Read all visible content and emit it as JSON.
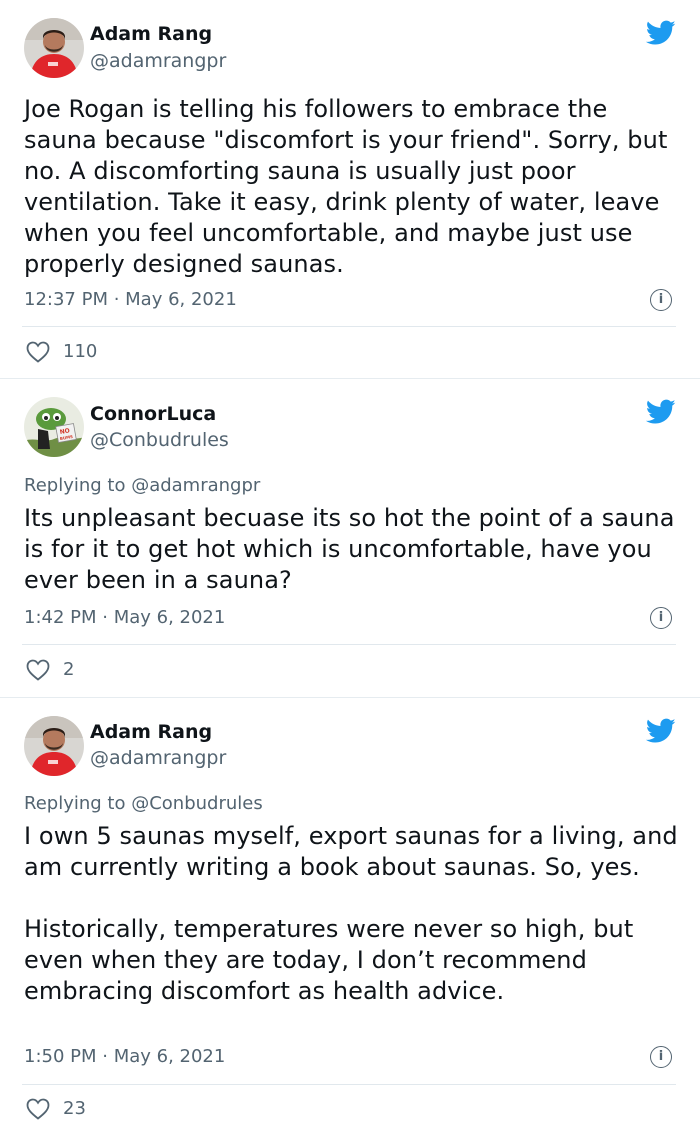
{
  "tweets": [
    {
      "author": "Adam Rang",
      "handle": "@adamrangpr",
      "replying_to": "",
      "text": "Joe Rogan is telling his followers to embrace the sauna because \"discomfort is your friend\". Sorry, but no. A discomforting sauna is usually just poor ventilation. Take it easy, drink plenty of water, leave when you feel uncomfortable, and maybe just use properly designed saunas.",
      "timestamp": "12:37 PM · May 6, 2021",
      "likes": "110"
    },
    {
      "author": "ConnorLuca",
      "handle": "@Conbudrules",
      "replying_to": "Replying to @adamrangpr",
      "text": "Its unpleasant becuase its so hot the point of a sauna is for it to get hot which is uncomfortable, have you ever been in a sauna?",
      "timestamp": "1:42 PM · May 6, 2021",
      "likes": "2"
    },
    {
      "author": "Adam Rang",
      "handle": "@adamrangpr",
      "replying_to": "Replying to @Conbudrules",
      "text": "I own 5 saunas myself, export saunas for a living, and am currently writing a book about saunas. So, yes.\n\nHistorically, temperatures were never so high, but even when they are today, I don’t recommend embracing discomfort as health advice.",
      "timestamp": "1:50 PM · May 6, 2021",
      "likes": "23"
    }
  ],
  "colors": {
    "twitter_blue": "#1d9bf0",
    "text_primary": "#0f1419",
    "text_secondary": "#536471",
    "divider": "#e1e8ed"
  },
  "icons": {
    "brand": "twitter-bird-icon",
    "info": "info-icon",
    "like": "heart-icon"
  }
}
